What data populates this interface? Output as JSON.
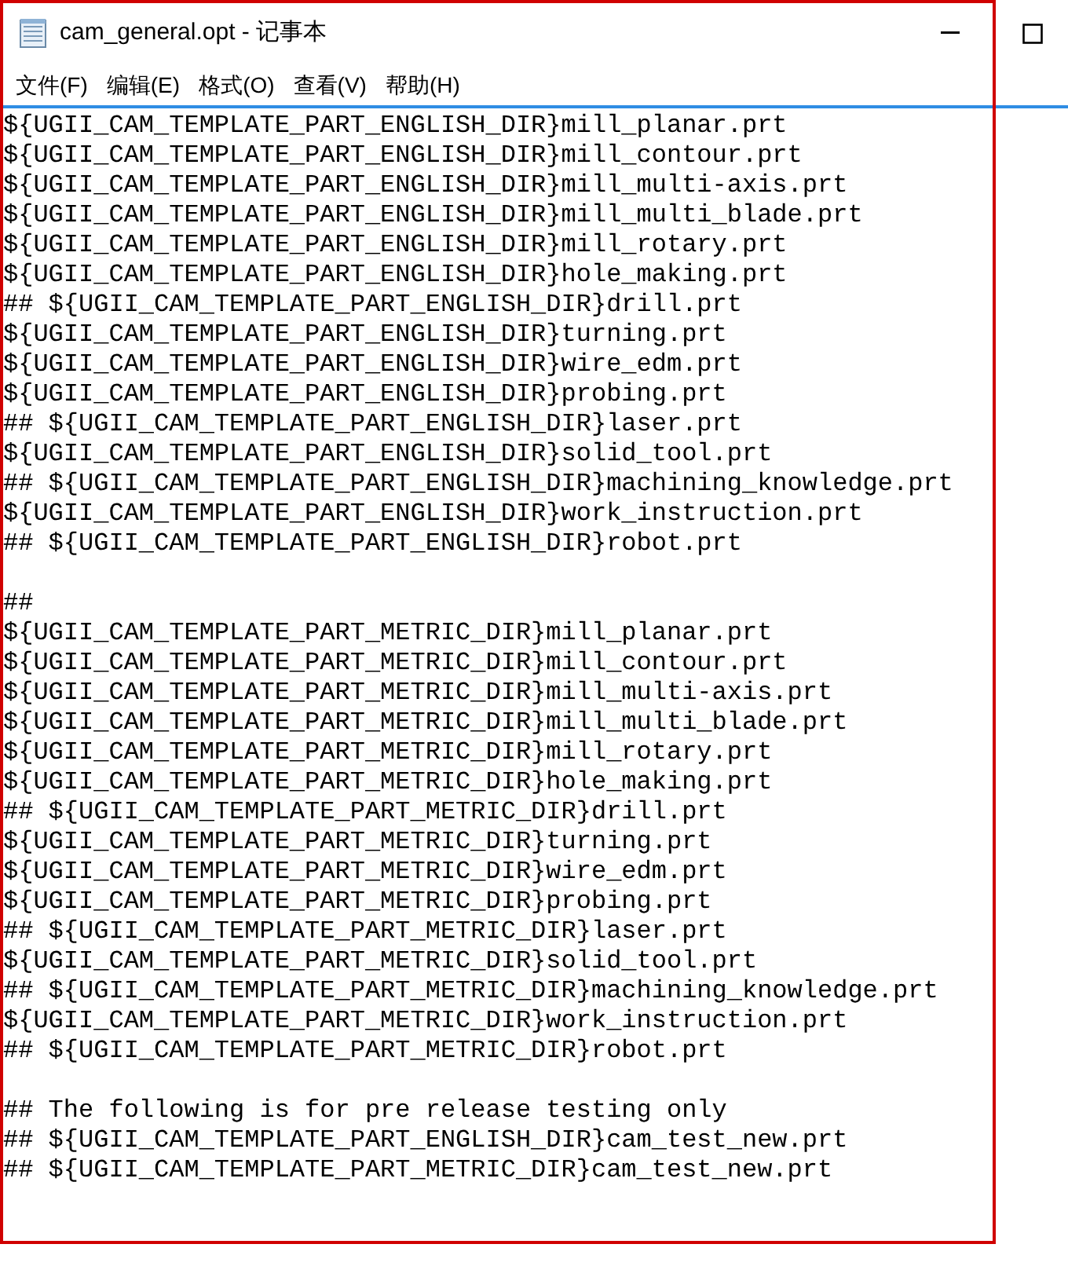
{
  "window": {
    "title": "cam_general.opt - 记事本"
  },
  "menu": [
    "文件(F)",
    "编辑(E)",
    "格式(O)",
    "查看(V)",
    "帮助(H)"
  ],
  "text_blocks": [
    [
      "${UGII_CAM_TEMPLATE_PART_ENGLISH_DIR}mill_planar.prt",
      "${UGII_CAM_TEMPLATE_PART_ENGLISH_DIR}mill_contour.prt",
      "${UGII_CAM_TEMPLATE_PART_ENGLISH_DIR}mill_multi-axis.prt",
      "${UGII_CAM_TEMPLATE_PART_ENGLISH_DIR}mill_multi_blade.prt",
      "${UGII_CAM_TEMPLATE_PART_ENGLISH_DIR}mill_rotary.prt",
      "${UGII_CAM_TEMPLATE_PART_ENGLISH_DIR}hole_making.prt",
      "## ${UGII_CAM_TEMPLATE_PART_ENGLISH_DIR}drill.prt",
      "${UGII_CAM_TEMPLATE_PART_ENGLISH_DIR}turning.prt",
      "${UGII_CAM_TEMPLATE_PART_ENGLISH_DIR}wire_edm.prt",
      "${UGII_CAM_TEMPLATE_PART_ENGLISH_DIR}probing.prt",
      "## ${UGII_CAM_TEMPLATE_PART_ENGLISH_DIR}laser.prt",
      "${UGII_CAM_TEMPLATE_PART_ENGLISH_DIR}solid_tool.prt",
      "## ${UGII_CAM_TEMPLATE_PART_ENGLISH_DIR}machining_knowledge.prt",
      "${UGII_CAM_TEMPLATE_PART_ENGLISH_DIR}work_instruction.prt",
      "## ${UGII_CAM_TEMPLATE_PART_ENGLISH_DIR}robot.prt"
    ],
    [
      "##",
      "${UGII_CAM_TEMPLATE_PART_METRIC_DIR}mill_planar.prt",
      "${UGII_CAM_TEMPLATE_PART_METRIC_DIR}mill_contour.prt",
      "${UGII_CAM_TEMPLATE_PART_METRIC_DIR}mill_multi-axis.prt",
      "${UGII_CAM_TEMPLATE_PART_METRIC_DIR}mill_multi_blade.prt",
      "${UGII_CAM_TEMPLATE_PART_METRIC_DIR}mill_rotary.prt",
      "${UGII_CAM_TEMPLATE_PART_METRIC_DIR}hole_making.prt",
      "## ${UGII_CAM_TEMPLATE_PART_METRIC_DIR}drill.prt",
      "${UGII_CAM_TEMPLATE_PART_METRIC_DIR}turning.prt",
      "${UGII_CAM_TEMPLATE_PART_METRIC_DIR}wire_edm.prt",
      "${UGII_CAM_TEMPLATE_PART_METRIC_DIR}probing.prt",
      "## ${UGII_CAM_TEMPLATE_PART_METRIC_DIR}laser.prt",
      "${UGII_CAM_TEMPLATE_PART_METRIC_DIR}solid_tool.prt",
      "## ${UGII_CAM_TEMPLATE_PART_METRIC_DIR}machining_knowledge.prt",
      "${UGII_CAM_TEMPLATE_PART_METRIC_DIR}work_instruction.prt",
      "## ${UGII_CAM_TEMPLATE_PART_METRIC_DIR}robot.prt"
    ],
    [
      "## The following is for pre release testing only",
      "## ${UGII_CAM_TEMPLATE_PART_ENGLISH_DIR}cam_test_new.prt",
      "## ${UGII_CAM_TEMPLATE_PART_METRIC_DIR}cam_test_new.prt"
    ]
  ]
}
